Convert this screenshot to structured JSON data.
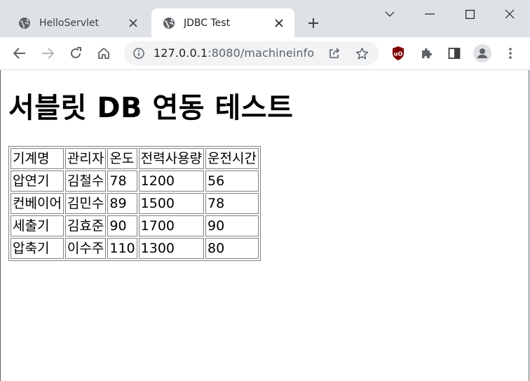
{
  "tabs": [
    {
      "title": "HelloServlet",
      "icon": "globe-icon",
      "active": false
    },
    {
      "title": "JDBC Test",
      "icon": "globe-icon",
      "active": true
    }
  ],
  "address": {
    "host": "127.0.0.1",
    "port_path": ":8080/machineinfo"
  },
  "page": {
    "heading": "서블릿 DB 연동 테스트",
    "table": {
      "headers": [
        "기계명",
        "관리자",
        "온도",
        "전력사용량",
        "운전시간"
      ],
      "rows": [
        [
          "압연기",
          "김철수",
          "78",
          "1200",
          "56"
        ],
        [
          "컨베이어",
          "김민수",
          "89",
          "1500",
          "78"
        ],
        [
          "세출기",
          "김효준",
          "90",
          "1700",
          "90"
        ],
        [
          "압축기",
          "이수주",
          "110",
          "1300",
          "80"
        ]
      ]
    }
  },
  "colors": {
    "tabbar": "#dee1e6",
    "active_tab": "#ffffff",
    "omnibox": "#f1f3f4",
    "ublock": "#800000"
  }
}
